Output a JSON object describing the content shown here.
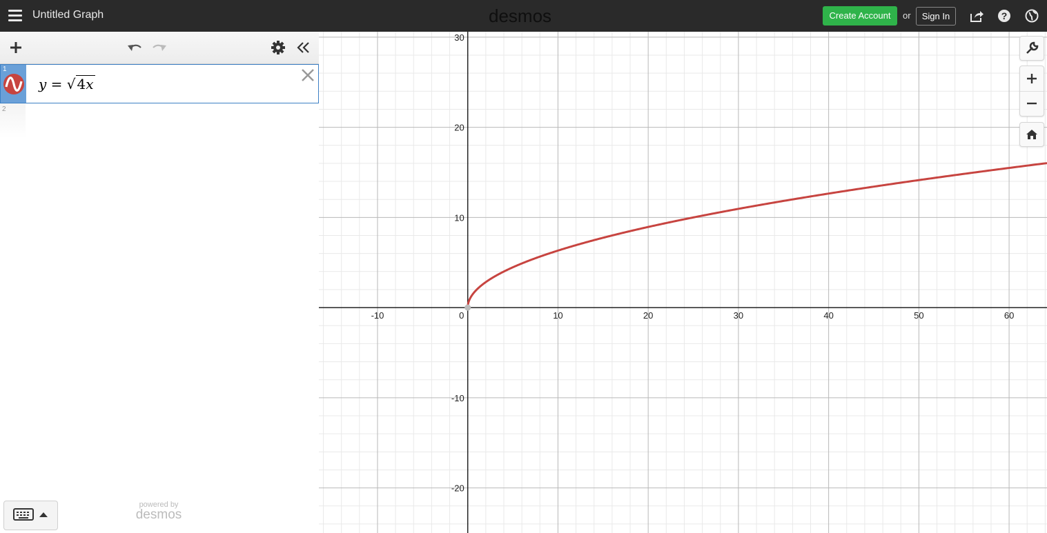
{
  "header": {
    "title": "Untitled Graph",
    "logo": "desmos",
    "create_account": "Create Account",
    "or": "or",
    "sign_in": "Sign In",
    "icons": [
      "menu-icon",
      "share-icon",
      "help-icon",
      "globe-icon"
    ]
  },
  "toolbar": {
    "icons": [
      "add-icon",
      "undo-icon",
      "redo-icon",
      "gear-icon",
      "collapse-icon"
    ]
  },
  "expressions": [
    {
      "number": "1",
      "lhs": "y",
      "equals": "=",
      "radicand_coef": "4",
      "radicand_var": "x",
      "color": "#c74440"
    },
    {
      "number": "2"
    }
  ],
  "footer": {
    "powered_by": "powered by",
    "brand": "desmos"
  },
  "graph": {
    "x_ticks": [
      "-10",
      "0",
      "10",
      "20",
      "30",
      "40",
      "50",
      "60"
    ],
    "y_ticks": [
      "30",
      "20",
      "10",
      "-10",
      "-20"
    ],
    "xlim": [
      -16.5,
      64.2
    ],
    "ylim": [
      -25,
      30.6
    ],
    "curve_color": "#c74440",
    "controls": [
      "wrench-icon",
      "zoom-in-icon",
      "zoom-out-icon",
      "home-icon"
    ]
  },
  "chart_data": {
    "type": "line",
    "series": [
      {
        "name": "y = √(4x)",
        "function": "sqrt(4x)",
        "color": "#c74440"
      }
    ],
    "x": [
      0,
      1,
      4,
      9,
      16,
      25,
      36,
      49,
      64
    ],
    "y": [
      0,
      2,
      4,
      6,
      8,
      10,
      12,
      14,
      16
    ],
    "xlim": [
      -16.5,
      64.2
    ],
    "ylim": [
      -25,
      30.6
    ],
    "grid": true,
    "major_tick_step": 10,
    "minor_tick_step": 2
  }
}
